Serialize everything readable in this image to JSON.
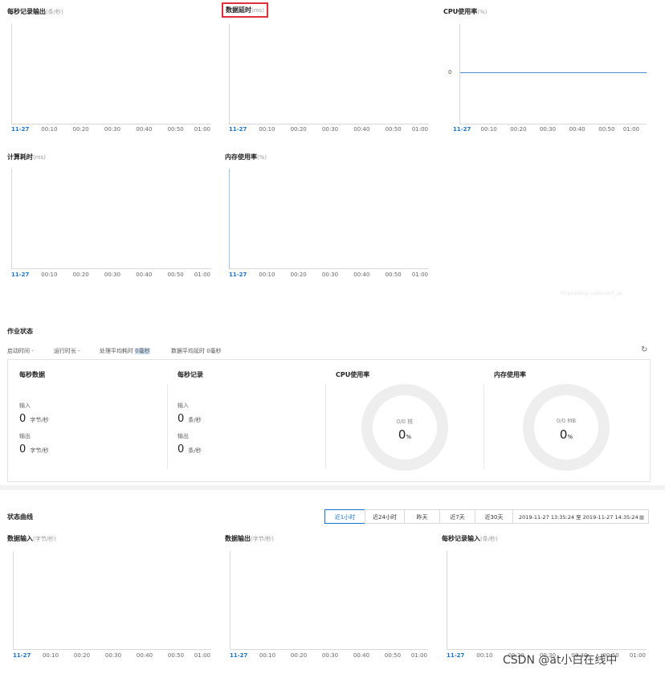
{
  "top_charts": {
    "tick_labels": [
      "11-27",
      "00:10",
      "00:20",
      "00:30",
      "00:40",
      "00:50",
      "01:00"
    ],
    "records_out": {
      "title": "每秒记录输出",
      "unit": "(条/秒)"
    },
    "data_latency": {
      "title": "数据延时",
      "unit": "(ms)"
    },
    "cpu": {
      "title": "CPU使用率",
      "unit": "(%)",
      "y_label": "0"
    },
    "compute_time": {
      "title": "计算耗时",
      "unit": "(ms)"
    },
    "memory": {
      "title": "内存使用率",
      "unit": "(%)"
    }
  },
  "chart_data": [
    {
      "type": "line",
      "title": "每秒记录输出(条/秒)",
      "x": [
        "11-27",
        "00:10",
        "00:20",
        "00:30",
        "00:40",
        "00:50",
        "01:00"
      ],
      "series": []
    },
    {
      "type": "line",
      "title": "数据延时(ms)",
      "x": [
        "11-27",
        "00:10",
        "00:20",
        "00:30",
        "00:40",
        "00:50",
        "01:00"
      ],
      "series": []
    },
    {
      "type": "line",
      "title": "CPU使用率(%)",
      "x": [
        "11-27",
        "00:10",
        "00:20",
        "00:30",
        "00:40",
        "00:50",
        "01:00"
      ],
      "yticks": [
        "0"
      ],
      "series": [
        {
          "values": [
            0,
            0,
            0,
            0,
            0,
            0,
            0
          ]
        }
      ]
    },
    {
      "type": "line",
      "title": "计算耗时(ms)",
      "x": [
        "11-27",
        "00:10",
        "00:20",
        "00:30",
        "00:40",
        "00:50",
        "01:00"
      ],
      "series": []
    },
    {
      "type": "line",
      "title": "内存使用率(%)",
      "x": [
        "11-27",
        "00:10",
        "00:20",
        "00:30",
        "00:40",
        "00:50",
        "01:00"
      ],
      "series": []
    },
    {
      "type": "line",
      "title": "数据输入(字节/秒)",
      "x": [
        "11-27",
        "00:10",
        "00:20",
        "00:30",
        "00:40",
        "00:50",
        "01:00"
      ],
      "series": []
    },
    {
      "type": "line",
      "title": "数据输出(字节/秒)",
      "x": [
        "11-27",
        "00:10",
        "00:20",
        "00:30",
        "00:40",
        "00:50",
        "01:00"
      ],
      "series": []
    },
    {
      "type": "line",
      "title": "每秒记录输入(条/秒)",
      "x": [
        "11-27",
        "00:10",
        "00:20",
        "00:30",
        "00:40",
        "00:50",
        "01:00"
      ],
      "series": []
    }
  ],
  "job_status": {
    "title": "作业状态",
    "start_time": "启动时间 -",
    "run_duration": "运行时长 -",
    "avg_process_label": "处理平均耗时",
    "avg_process_value": "0毫秒",
    "avg_latency": "数据平均延时 0毫秒",
    "refresh_icon": "refresh-icon",
    "per_second_data": {
      "title": "每秒数据",
      "in_label": "输入",
      "in_value": "0",
      "in_unit": "字节/秒",
      "out_label": "输出",
      "out_value": "0",
      "out_unit": "字节/秒"
    },
    "per_second_records": {
      "title": "每秒记录",
      "in_label": "输入",
      "in_value": "0",
      "in_unit": "条/秒",
      "out_label": "输出",
      "out_value": "0",
      "out_unit": "条/秒"
    },
    "cpu": {
      "title": "CPU使用率",
      "caption": "0/0 核",
      "value": "0",
      "unit": "%"
    },
    "memory": {
      "title": "内存使用率",
      "caption": "0/0 MB",
      "value": "0",
      "unit": "%"
    }
  },
  "status_curves": {
    "title": "状态曲线",
    "tabs": [
      "近1小时",
      "近24小时",
      "昨天",
      "近7天",
      "近30天"
    ],
    "active_tab": "近1小时",
    "date_range": "2019-11-27 13:35:24 至 2019-11-27 14:35:24",
    "calendar_icon": "calendar-icon",
    "data_in": {
      "title": "数据输入",
      "unit": "(字节/秒)"
    },
    "data_out": {
      "title": "数据输出",
      "unit": "(字节/秒)"
    },
    "records_in": {
      "title": "每秒记录输入",
      "unit": "(条/秒)"
    }
  },
  "watermark": "CSDN @at小白在线中",
  "faint_url": "https://blog.csdn.net/t_ux"
}
